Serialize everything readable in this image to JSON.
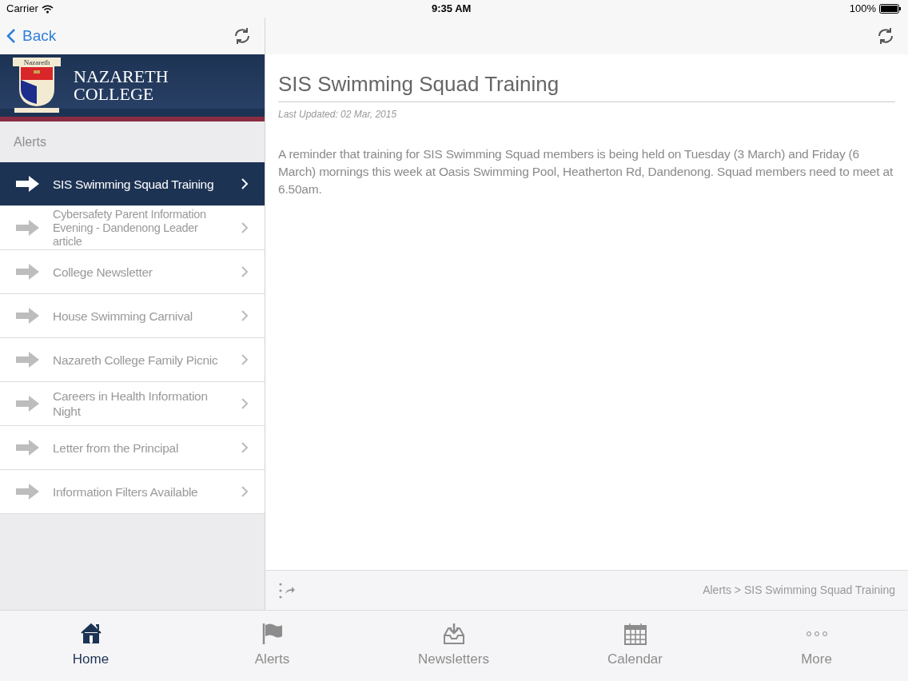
{
  "status_bar": {
    "carrier": "Carrier",
    "time": "9:35 AM",
    "battery": "100%"
  },
  "left_nav": {
    "back": "Back"
  },
  "banner": {
    "line_1": "NAZARETH",
    "line_2": "COLLEGE",
    "crest_text": "Nazareth"
  },
  "section_label": "Alerts",
  "alerts": [
    {
      "title": "SIS Swimming Squad Training",
      "selected": true
    },
    {
      "title": "Cybersafety Parent Information Evening - Dandenong Leader article",
      "selected": false
    },
    {
      "title": "College Newsletter",
      "selected": false
    },
    {
      "title": "House Swimming Carnival",
      "selected": false
    },
    {
      "title": "Nazareth College Family Picnic",
      "selected": false
    },
    {
      "title": "Careers in Health Information Night",
      "selected": false
    },
    {
      "title": "Letter from the Principal",
      "selected": false
    },
    {
      "title": "Information Filters Available",
      "selected": false
    }
  ],
  "article": {
    "title": "SIS Swimming Squad Training",
    "updated": "Last Updated: 02 Mar, 2015",
    "body": "A reminder that training for SIS Swimming Squad members is being held on Tuesday (3 March) and Friday (6 March) mornings this week at Oasis Swimming Pool, Heatherton Rd, Dandenong. Squad members need to meet at 6.50am."
  },
  "breadcrumb": "Alerts > SIS Swimming Squad Training",
  "tabs": [
    {
      "label": "Home",
      "kind": "home",
      "selected": true
    },
    {
      "label": "Alerts",
      "kind": "flag",
      "selected": false
    },
    {
      "label": "Newsletters",
      "kind": "inbox",
      "selected": false
    },
    {
      "label": "Calendar",
      "kind": "calendar",
      "selected": false
    },
    {
      "label": "More",
      "kind": "more",
      "selected": false
    }
  ]
}
